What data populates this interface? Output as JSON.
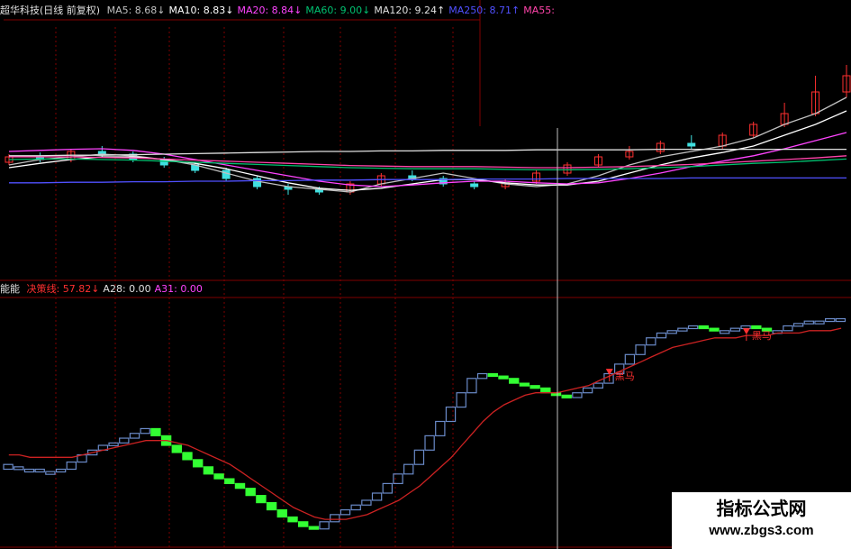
{
  "header": {
    "title": "超华科技(日线 前复权)",
    "ma_items": [
      {
        "label": "MA5: 8.68",
        "arrow": "↓",
        "color": "#c0c0c0"
      },
      {
        "label": "MA10: 8.83",
        "arrow": "↓",
        "color": "#ffffff"
      },
      {
        "label": "MA20: 8.84",
        "arrow": "↓",
        "color": "#ff44ff"
      },
      {
        "label": "MA60: 9.00",
        "arrow": "↓",
        "color": "#00c070"
      },
      {
        "label": "MA120: 9.24",
        "arrow": "↑",
        "color": "#e0e0e0"
      },
      {
        "label": "MA250: 8.71",
        "arrow": "↑",
        "color": "#5050ff"
      },
      {
        "label": "MA55:",
        "arrow": "",
        "color": "#ff44aa"
      }
    ]
  },
  "indicator_header": {
    "name": "能能",
    "items": [
      {
        "label": "决策线: 57.82",
        "arrow": "↓",
        "color": "#ff3030"
      },
      {
        "label": "A28: 0.00",
        "arrow": "",
        "color": "#e0e0e0"
      },
      {
        "label": "A31: 0.00",
        "arrow": "",
        "color": "#ff44ff"
      }
    ]
  },
  "annotations": {
    "signal_label": "黑马"
  },
  "watermark": {
    "line1": "指标公式网",
    "line2": "www.zbgs3.com"
  },
  "colors": {
    "background": "#000000",
    "up_candle": "#ff3030",
    "down_candle": "#40e0e0",
    "rising_block": "#6a8ac8",
    "falling_block": "#33ff33",
    "decision_line": "#cc2222",
    "grid": "#800000",
    "crosshair": "#c0c0c0"
  },
  "chart_data": [
    {
      "type": "candlestick",
      "title": "超华科技(日线 前复权)",
      "series_names": [
        "MA5",
        "MA10",
        "MA20",
        "MA60",
        "MA120",
        "MA250",
        "MA55"
      ],
      "ylim": [
        7.0,
        11.0
      ],
      "ma": {
        "MA5": [
          8.95,
          9.05,
          9.1,
          9.15,
          9.12,
          9.05,
          8.95,
          8.8,
          8.65,
          8.55,
          8.5,
          8.45,
          8.6,
          8.7,
          8.8,
          8.7,
          8.6,
          8.55,
          8.6,
          8.75,
          8.95,
          9.1,
          9.2,
          9.3,
          9.45,
          9.7,
          9.9,
          10.2
        ],
        "MA10": [
          8.9,
          8.98,
          9.05,
          9.1,
          9.1,
          9.05,
          8.98,
          8.88,
          8.75,
          8.62,
          8.52,
          8.48,
          8.52,
          8.6,
          8.68,
          8.68,
          8.62,
          8.58,
          8.58,
          8.65,
          8.8,
          8.95,
          9.08,
          9.18,
          9.3,
          9.5,
          9.7,
          9.95
        ],
        "MA20": [
          9.2,
          9.22,
          9.24,
          9.25,
          9.22,
          9.15,
          9.05,
          8.95,
          8.85,
          8.75,
          8.65,
          8.58,
          8.55,
          8.58,
          8.62,
          8.65,
          8.65,
          8.62,
          8.6,
          8.62,
          8.7,
          8.8,
          8.92,
          9.02,
          9.12,
          9.25,
          9.4,
          9.55
        ],
        "MA60": [
          9.05,
          9.06,
          9.06,
          9.05,
          9.04,
          9.02,
          9.0,
          8.98,
          8.96,
          8.94,
          8.92,
          8.9,
          8.89,
          8.88,
          8.88,
          8.88,
          8.87,
          8.86,
          8.86,
          8.87,
          8.88,
          8.9,
          8.92,
          8.95,
          8.98,
          9.0,
          9.03,
          9.06
        ],
        "MA120": [
          9.12,
          9.12,
          9.13,
          9.13,
          9.14,
          9.15,
          9.16,
          9.17,
          9.18,
          9.19,
          9.2,
          9.2,
          9.21,
          9.21,
          9.22,
          9.22,
          9.22,
          9.23,
          9.23,
          9.23,
          9.23,
          9.24,
          9.24,
          9.24,
          9.24,
          9.24,
          9.24,
          9.24
        ],
        "MA250": [
          8.62,
          8.62,
          8.63,
          8.63,
          8.64,
          8.64,
          8.65,
          8.65,
          8.66,
          8.66,
          8.67,
          8.67,
          8.68,
          8.68,
          8.68,
          8.69,
          8.69,
          8.69,
          8.7,
          8.7,
          8.7,
          8.7,
          8.71,
          8.71,
          8.71,
          8.71,
          8.71,
          8.71
        ],
        "MA55": [
          9.1,
          9.1,
          9.1,
          9.09,
          9.08,
          9.06,
          9.04,
          9.02,
          9.0,
          8.98,
          8.96,
          8.94,
          8.93,
          8.92,
          8.92,
          8.92,
          8.91,
          8.9,
          8.9,
          8.91,
          8.92,
          8.94,
          8.96,
          8.99,
          9.02,
          9.05,
          9.08,
          9.12
        ]
      },
      "candles": [
        [
          9.0,
          9.1,
          9.15,
          8.95
        ],
        [
          9.1,
          9.05,
          9.18,
          9.0
        ],
        [
          9.05,
          9.2,
          9.25,
          9.0
        ],
        [
          9.2,
          9.15,
          9.3,
          9.1
        ],
        [
          9.15,
          9.05,
          9.2,
          9.0
        ],
        [
          9.05,
          8.95,
          9.1,
          8.9
        ],
        [
          8.95,
          8.85,
          9.0,
          8.8
        ],
        [
          8.85,
          8.7,
          8.9,
          8.65
        ],
        [
          8.7,
          8.55,
          8.75,
          8.5
        ],
        [
          8.55,
          8.5,
          8.6,
          8.4
        ],
        [
          8.5,
          8.45,
          8.55,
          8.4
        ],
        [
          8.45,
          8.6,
          8.65,
          8.4
        ],
        [
          8.6,
          8.75,
          8.8,
          8.55
        ],
        [
          8.75,
          8.7,
          8.85,
          8.65
        ],
        [
          8.7,
          8.6,
          8.75,
          8.55
        ],
        [
          8.6,
          8.55,
          8.65,
          8.5
        ],
        [
          8.55,
          8.65,
          8.7,
          8.5
        ],
        [
          8.65,
          8.8,
          8.85,
          8.6
        ],
        [
          8.8,
          8.95,
          9.0,
          8.75
        ],
        [
          8.95,
          9.1,
          9.15,
          8.9
        ],
        [
          9.1,
          9.2,
          9.3,
          9.05
        ],
        [
          9.2,
          9.35,
          9.4,
          9.15
        ],
        [
          9.35,
          9.3,
          9.5,
          9.25
        ],
        [
          9.3,
          9.5,
          9.55,
          9.25
        ],
        [
          9.5,
          9.7,
          9.75,
          9.45
        ],
        [
          9.7,
          9.9,
          10.1,
          9.65
        ],
        [
          9.9,
          10.3,
          10.6,
          9.85
        ],
        [
          10.3,
          10.6,
          10.8,
          10.2
        ]
      ]
    },
    {
      "type": "bar",
      "title": "能能",
      "series": [
        {
          "name": "决策线",
          "color": "#cc2222"
        },
        {
          "name": "A28"
        },
        {
          "name": "A31"
        }
      ],
      "ylim": [
        0,
        100
      ],
      "blocks": [
        [
          30,
          32
        ],
        [
          30,
          31
        ],
        [
          30,
          30
        ],
        [
          29,
          30
        ],
        [
          29,
          29
        ],
        [
          29,
          30
        ],
        [
          30,
          33
        ],
        [
          33,
          36
        ],
        [
          36,
          38
        ],
        [
          38,
          40
        ],
        [
          40,
          41
        ],
        [
          41,
          43
        ],
        [
          43,
          45
        ],
        [
          45,
          47
        ],
        [
          47,
          44
        ],
        [
          44,
          40
        ],
        [
          40,
          37
        ],
        [
          37,
          34
        ],
        [
          34,
          31
        ],
        [
          31,
          28
        ],
        [
          28,
          26
        ],
        [
          26,
          24
        ],
        [
          24,
          22
        ],
        [
          22,
          19
        ],
        [
          19,
          16
        ],
        [
          16,
          13
        ],
        [
          13,
          10
        ],
        [
          10,
          8
        ],
        [
          8,
          6
        ],
        [
          6,
          5
        ],
        [
          5,
          8
        ],
        [
          8,
          11
        ],
        [
          11,
          13
        ],
        [
          13,
          15
        ],
        [
          15,
          17
        ],
        [
          17,
          20
        ],
        [
          20,
          24
        ],
        [
          24,
          28
        ],
        [
          28,
          32
        ],
        [
          32,
          38
        ],
        [
          38,
          44
        ],
        [
          44,
          50
        ],
        [
          50,
          56
        ],
        [
          56,
          62
        ],
        [
          62,
          68
        ],
        [
          68,
          70
        ],
        [
          70,
          69
        ],
        [
          69,
          68
        ],
        [
          68,
          66
        ],
        [
          66,
          65
        ],
        [
          65,
          64
        ],
        [
          64,
          62
        ],
        [
          62,
          61
        ],
        [
          61,
          60
        ],
        [
          60,
          62
        ],
        [
          62,
          64
        ],
        [
          64,
          66
        ],
        [
          66,
          70
        ],
        [
          70,
          74
        ],
        [
          74,
          78
        ],
        [
          78,
          82
        ],
        [
          82,
          85
        ],
        [
          85,
          87
        ],
        [
          87,
          88
        ],
        [
          88,
          89
        ],
        [
          89,
          90
        ],
        [
          90,
          89
        ],
        [
          89,
          88
        ],
        [
          88,
          88
        ],
        [
          88,
          89
        ],
        [
          89,
          90
        ],
        [
          90,
          89
        ],
        [
          89,
          88
        ],
        [
          88,
          88
        ],
        [
          88,
          90
        ],
        [
          90,
          91
        ],
        [
          91,
          92
        ],
        [
          92,
          92
        ],
        [
          92,
          93
        ],
        [
          93,
          93
        ]
      ],
      "decision_line": [
        36,
        36,
        35,
        35,
        35,
        35,
        35,
        36,
        37,
        38,
        39,
        40,
        41,
        42,
        42,
        42,
        41,
        40,
        38,
        36,
        34,
        32,
        29,
        26,
        23,
        20,
        17,
        14,
        12,
        10,
        9,
        9,
        9,
        10,
        11,
        13,
        15,
        17,
        20,
        23,
        27,
        31,
        35,
        40,
        45,
        50,
        54,
        57,
        59,
        61,
        62,
        62,
        62,
        63,
        64,
        65,
        67,
        69,
        71,
        73,
        75,
        77,
        79,
        81,
        82,
        83,
        84,
        85,
        85,
        85,
        86,
        86,
        86,
        87,
        87,
        87,
        88,
        88,
        88,
        89
      ],
      "signal_indices": [
        57,
        70
      ]
    }
  ]
}
